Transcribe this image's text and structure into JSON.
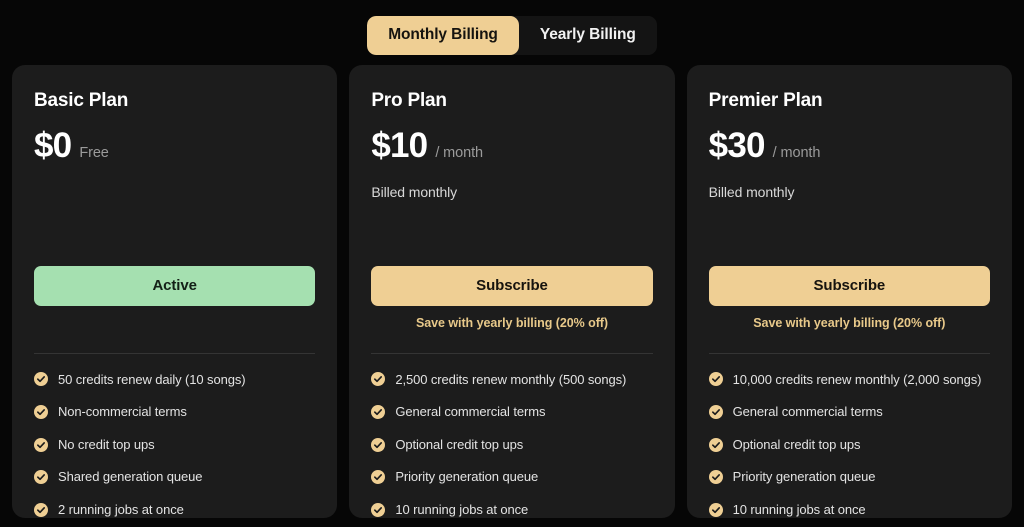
{
  "billing_toggle": {
    "monthly_label": "Monthly Billing",
    "yearly_label": "Yearly Billing",
    "selected": "Monthly Billing"
  },
  "colors": {
    "page_background": "#060606",
    "card_background": "#1c1c1c",
    "accent_tan": "#efcf94",
    "accent_mint": "#a5e0b0",
    "save_note_text": "#e8c98a",
    "divider": "#343434"
  },
  "plans": [
    {
      "name": "Basic Plan",
      "price": "$0",
      "price_suffix": "Free",
      "billing_note": "",
      "cta_label": "Active",
      "cta_state": "active",
      "save_note": "",
      "features": [
        "50 credits renew daily (10 songs)",
        "Non-commercial terms",
        "No credit top ups",
        "Shared generation queue",
        "2 running jobs at once"
      ]
    },
    {
      "name": "Pro Plan",
      "price": "$10",
      "price_suffix": "/ month",
      "billing_note": "Billed monthly",
      "cta_label": "Subscribe",
      "cta_state": "subscribe",
      "save_note": "Save with yearly billing (20% off)",
      "features": [
        "2,500 credits renew monthly (500 songs)",
        "General commercial terms",
        "Optional credit top ups",
        "Priority generation queue",
        "10 running jobs at once"
      ]
    },
    {
      "name": "Premier Plan",
      "price": "$30",
      "price_suffix": "/ month",
      "billing_note": "Billed monthly",
      "cta_label": "Subscribe",
      "cta_state": "subscribe",
      "save_note": "Save with yearly billing (20% off)",
      "features": [
        "10,000 credits renew monthly (2,000 songs)",
        "General commercial terms",
        "Optional credit top ups",
        "Priority generation queue",
        "10 running jobs at once"
      ]
    }
  ],
  "icons": {
    "check_circle": "check-circle-icon"
  }
}
